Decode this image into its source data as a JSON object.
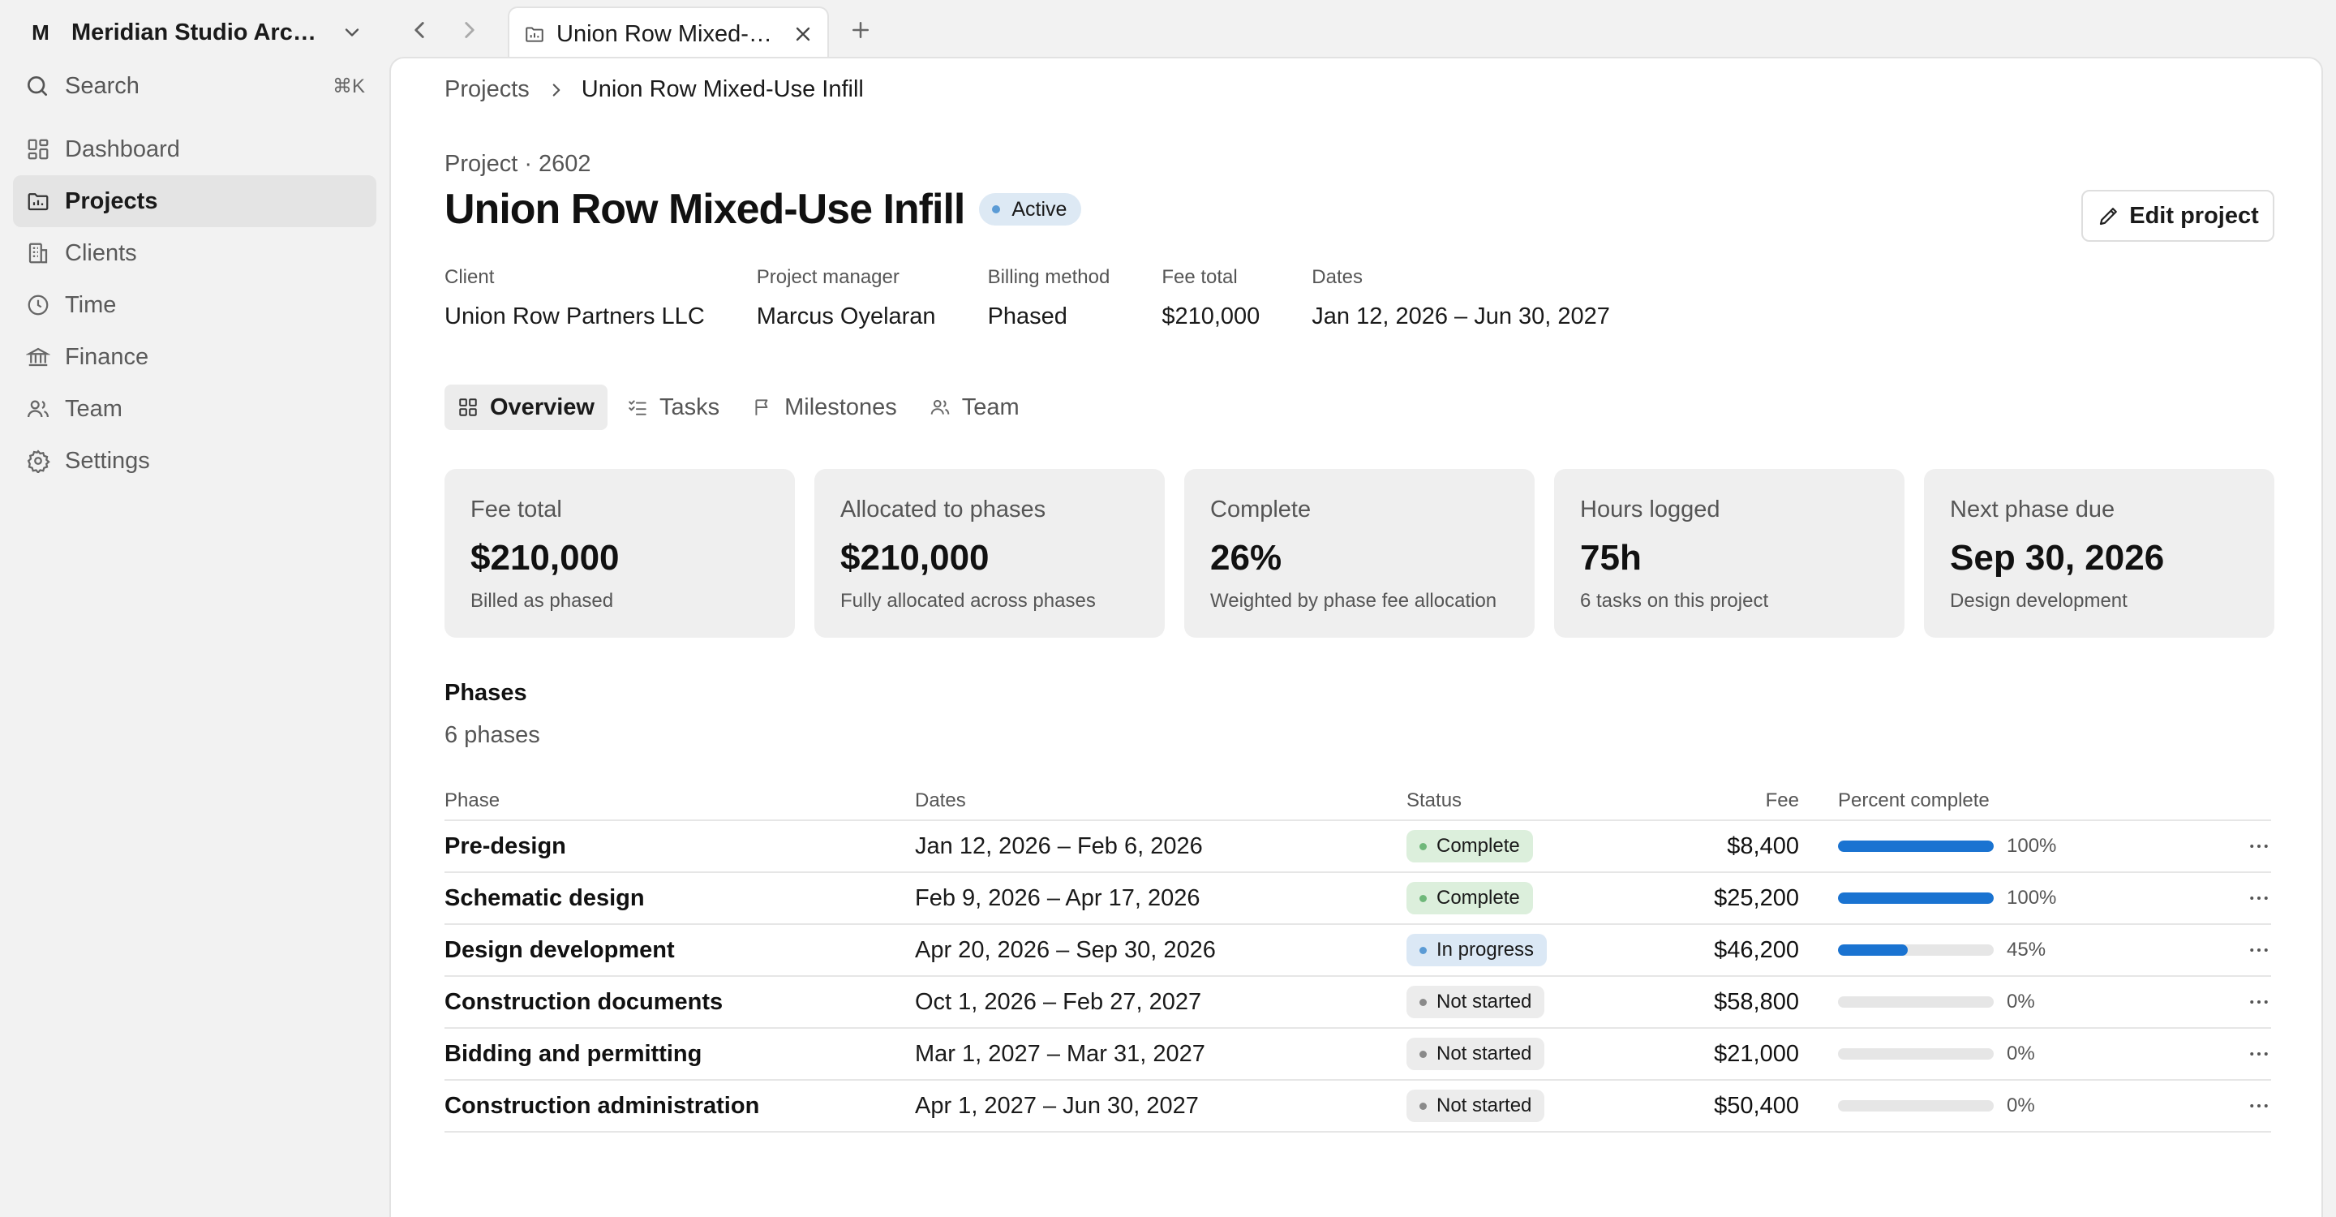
{
  "colors": {
    "accent": "#1a73d1",
    "active_badge_bg": "#dde9f4",
    "active_dot": "#5b9bd5",
    "complete_bg": "#dcefdc",
    "complete_dot": "#6fb87a",
    "in_progress_bg": "#dbe8f5",
    "in_progress_dot": "#5b9bd5",
    "not_started_bg": "#ececec",
    "not_started_dot": "#8a8a8a"
  },
  "sidebar": {
    "workspace_initial": "M",
    "workspace_name": "Meridian Studio Archit...",
    "search_label": "Search",
    "search_shortcut": "⌘K",
    "items": [
      {
        "label": "Dashboard",
        "icon": "dashboard-icon"
      },
      {
        "label": "Projects",
        "icon": "folder-icon",
        "active": true
      },
      {
        "label": "Clients",
        "icon": "building-icon"
      },
      {
        "label": "Time",
        "icon": "clock-icon"
      },
      {
        "label": "Finance",
        "icon": "bank-icon"
      },
      {
        "label": "Team",
        "icon": "people-icon"
      },
      {
        "label": "Settings",
        "icon": "gear-icon"
      }
    ]
  },
  "tabbar": {
    "tab_label": "Union Row Mixed-Use Infill",
    "tab_icon": "folder-icon"
  },
  "breadcrumb": {
    "parent": "Projects",
    "current": "Union Row Mixed-Use Infill"
  },
  "project": {
    "id_line": "Project · 2602",
    "title": "Union Row Mixed-Use Infill",
    "status": "Active",
    "edit_label": "Edit project",
    "meta": [
      {
        "label": "Client",
        "value": "Union Row Partners LLC"
      },
      {
        "label": "Project manager",
        "value": "Marcus Oyelaran"
      },
      {
        "label": "Billing method",
        "value": "Phased"
      },
      {
        "label": "Fee total",
        "value": "$210,000"
      },
      {
        "label": "Dates",
        "value": "Jan 12, 2026 – Jun 30, 2027"
      }
    ]
  },
  "subtabs": [
    {
      "label": "Overview",
      "icon": "grid-icon",
      "active": true
    },
    {
      "label": "Tasks",
      "icon": "checklist-icon"
    },
    {
      "label": "Milestones",
      "icon": "flag-icon"
    },
    {
      "label": "Team",
      "icon": "people-icon"
    }
  ],
  "cards": [
    {
      "label": "Fee total",
      "value": "$210,000",
      "sub": "Billed as phased"
    },
    {
      "label": "Allocated to phases",
      "value": "$210,000",
      "sub": "Fully allocated across phases"
    },
    {
      "label": "Complete",
      "value": "26%",
      "sub": "Weighted by phase fee allocation"
    },
    {
      "label": "Hours logged",
      "value": "75h",
      "sub": "6 tasks on this project"
    },
    {
      "label": "Next phase due",
      "value": "Sep 30, 2026",
      "sub": "Design development"
    }
  ],
  "phases": {
    "heading": "Phases",
    "count": "6 phases",
    "columns": [
      "Phase",
      "Dates",
      "Status",
      "Fee",
      "Percent complete"
    ],
    "rows": [
      {
        "phase": "Pre-design",
        "dates": "Jan 12, 2026 – Feb 6, 2026",
        "status": "Complete",
        "status_kind": "complete",
        "fee": "$8,400",
        "pct": 100,
        "pct_label": "100%"
      },
      {
        "phase": "Schematic design",
        "dates": "Feb 9, 2026 – Apr 17, 2026",
        "status": "Complete",
        "status_kind": "complete",
        "fee": "$25,200",
        "pct": 100,
        "pct_label": "100%"
      },
      {
        "phase": "Design development",
        "dates": "Apr 20, 2026 – Sep 30, 2026",
        "status": "In progress",
        "status_kind": "in_progress",
        "fee": "$46,200",
        "pct": 45,
        "pct_label": "45%"
      },
      {
        "phase": "Construction documents",
        "dates": "Oct 1, 2026 – Feb 27, 2027",
        "status": "Not started",
        "status_kind": "not_started",
        "fee": "$58,800",
        "pct": 0,
        "pct_label": "0%"
      },
      {
        "phase": "Bidding and permitting",
        "dates": "Mar 1, 2027 – Mar 31, 2027",
        "status": "Not started",
        "status_kind": "not_started",
        "fee": "$21,000",
        "pct": 0,
        "pct_label": "0%"
      },
      {
        "phase": "Construction administration",
        "dates": "Apr 1, 2027 – Jun 30, 2027",
        "status": "Not started",
        "status_kind": "not_started",
        "fee": "$50,400",
        "pct": 0,
        "pct_label": "0%"
      }
    ]
  }
}
